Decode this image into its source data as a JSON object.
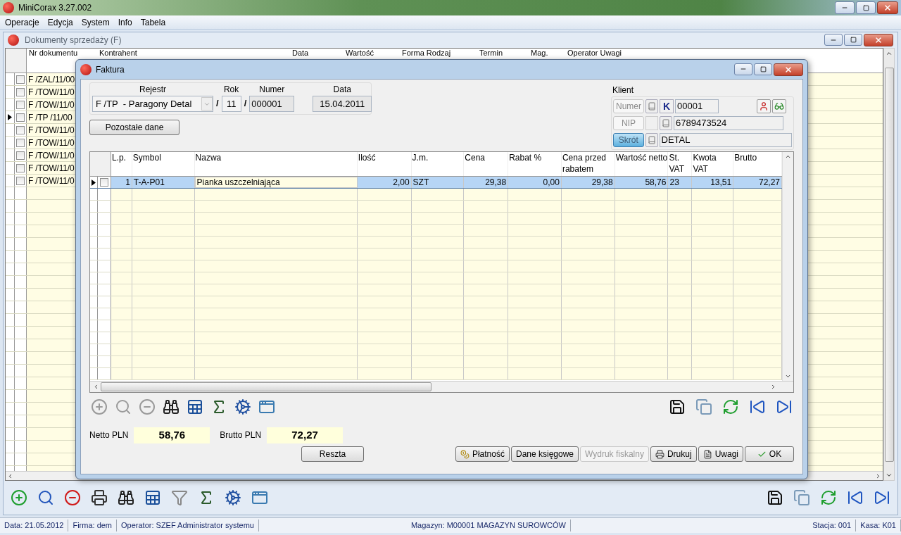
{
  "app": {
    "title": "MiniCorax 3.27.002"
  },
  "menu": [
    "Operacje",
    "Edycja",
    "System",
    "Info",
    "Tabela"
  ],
  "documents_window": {
    "title": "Dokumenty sprzedaży (F)",
    "columns": [
      "Nr dokumentu",
      "Kontrahent",
      "Data",
      "Wartość",
      "Forma Rodzaj",
      "Termin",
      "Mag.",
      "Operator Uwagi"
    ],
    "rows": [
      {
        "number": "F /ZAL/11/00",
        "checked": false,
        "selected": false
      },
      {
        "number": "F /TOW/11/0",
        "checked": false,
        "selected": false
      },
      {
        "number": "F /TOW/11/0",
        "checked": false,
        "selected": false
      },
      {
        "number": "F /TP /11/00",
        "checked": false,
        "selected": true
      },
      {
        "number": "F /TOW/11/0",
        "checked": false,
        "selected": false
      },
      {
        "number": "F /TOW/11/0",
        "checked": false,
        "selected": false
      },
      {
        "number": "F /TOW/11/0",
        "checked": false,
        "selected": false
      },
      {
        "number": "F /TOW/11/0",
        "checked": false,
        "selected": false
      },
      {
        "number": "F /TOW/11/0",
        "checked": false,
        "selected": false
      }
    ]
  },
  "invoice_dialog": {
    "title": "Faktura",
    "register": {
      "label": "Rejestr",
      "value": "F /TP  - Paragony Detal"
    },
    "separator_1": "/",
    "year": {
      "label": "Rok",
      "value": "11"
    },
    "separator_2": "/",
    "number": {
      "label": "Numer",
      "value": "000001"
    },
    "date": {
      "label": "Data",
      "value": "15.04.2011"
    },
    "other_data_button": "Pozostałe dane",
    "client": {
      "label": "Klient",
      "modes": [
        {
          "label": "Numer",
          "selected": false
        },
        {
          "label": "NIP",
          "selected": false
        },
        {
          "label": "Skrót",
          "selected": true
        }
      ],
      "kind_badge": "K",
      "number": "00001",
      "nip": "6789473524",
      "short_name": "DETAL"
    },
    "columns": [
      "L.p.",
      "Symbol",
      "Nazwa",
      "Ilość",
      "J.m.",
      "Cena",
      "Rabat %",
      "Cena przed rabatem",
      "Wartość netto",
      "St. VAT",
      "Kwota VAT",
      "Brutto"
    ],
    "rows": [
      {
        "selected": true,
        "checked": false,
        "cells": [
          "1",
          "T-A-P01",
          "Pianka uszczelniająca",
          "2,00",
          "SZT",
          "29,38",
          "0,00",
          "29,38",
          "58,76",
          "23",
          "13,51",
          "72,27"
        ]
      }
    ],
    "totals": [
      {
        "label": "Netto PLN",
        "value": "58,76"
      },
      {
        "label": "Brutto PLN",
        "value": "72,27"
      }
    ],
    "change_button": "Reszta",
    "buttons": [
      {
        "label": "Płatność",
        "kind": "coins",
        "disabled": false
      },
      {
        "label": "Dane księgowe",
        "kind": "plain",
        "disabled": false
      },
      {
        "label": "Wydruk fiskalny",
        "kind": "plain",
        "disabled": true
      },
      {
        "label": "Drukuj",
        "kind": "printer",
        "disabled": false
      },
      {
        "label": "Uwagi",
        "kind": "note",
        "disabled": false
      },
      {
        "label": "OK",
        "kind": "check",
        "disabled": false
      }
    ]
  },
  "status_bar": [
    {
      "text": "Data: 21.05.2012",
      "kind": "left"
    },
    {
      "text": "Firma: dem",
      "kind": "left"
    },
    {
      "text": "Operator: SZEF Administrator systemu",
      "kind": "left"
    },
    {
      "text": "Magazyn: M00001 MAGAZYN SUROWCÓW",
      "kind": "middle"
    },
    {
      "text": "Stacja: 001",
      "kind": "right"
    },
    {
      "text": "Kasa: K01",
      "kind": "right"
    }
  ]
}
